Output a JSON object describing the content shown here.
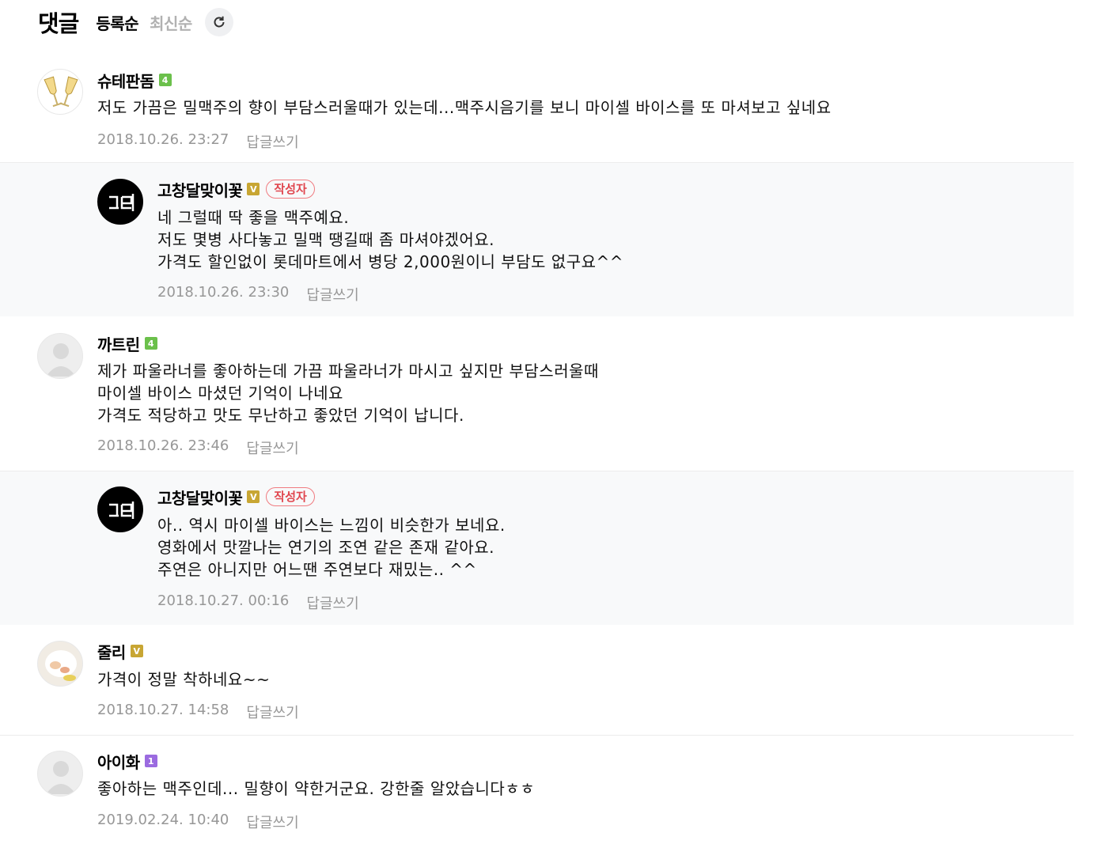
{
  "header": {
    "title": "댓글",
    "sort_registered": "등록순",
    "sort_latest": "최신순"
  },
  "reply_label": "답글쓰기",
  "comments": [
    {
      "nick": "슈테판돔",
      "badge": "4",
      "text": [
        "저도 가끔은 밀맥주의 향이 부담스러울때가 있는데...맥주시음기를 보니 마이셀 바이스를 또 마셔보고 싶네요"
      ],
      "date": "2018.10.26. 23:27"
    },
    {
      "nick": "고창달맞이꽃",
      "badge": "V",
      "author_tag": "작성자",
      "text": [
        "네 그럴때 딱 좋을 맥주예요.",
        "저도 몇병 사다놓고 밀맥 땡길때 좀 마셔야겠어요.",
        "가격도 할인없이 롯데마트에서 병당 2,000원이니 부담도 없구요^^"
      ],
      "date": "2018.10.26. 23:30"
    },
    {
      "nick": "까트린",
      "badge": "4",
      "text": [
        "제가 파울라너를 좋아하는데 가끔 파울라너가 마시고 싶지만 부담스러울때",
        "마이셀 바이스 마셨던 기억이 나네요",
        "가격도 적당하고 맛도 무난하고 좋았던 기억이 납니다."
      ],
      "date": "2018.10.26. 23:46"
    },
    {
      "nick": "고창달맞이꽃",
      "badge": "V",
      "author_tag": "작성자",
      "text": [
        "아.. 역시 마이셀 바이스는 느낌이 비슷한가 보네요.",
        "영화에서 맛깔나는 연기의 조연 같은 존재 같아요.",
        "주연은 아니지만 어느땐 주연보다 재밌는.. ^^"
      ],
      "date": "2018.10.27. 00:16"
    },
    {
      "nick": "줄리",
      "badge": "V",
      "text": [
        "가격이 정말 착하네요~~"
      ],
      "date": "2018.10.27. 14:58"
    },
    {
      "nick": "아이화",
      "badge": "1",
      "text": [
        "좋아하는 맥주인데... 밀향이 약한거군요. 강한줄 알았습니다ㅎㅎ"
      ],
      "date": "2019.02.24. 10:40"
    }
  ],
  "colors": {
    "author_tag": "#e0474f",
    "badge_green": "#6bc04b",
    "badge_gold": "#c8a633",
    "badge_purple": "#9b6be0",
    "reply_bg": "#f8f9fa"
  }
}
